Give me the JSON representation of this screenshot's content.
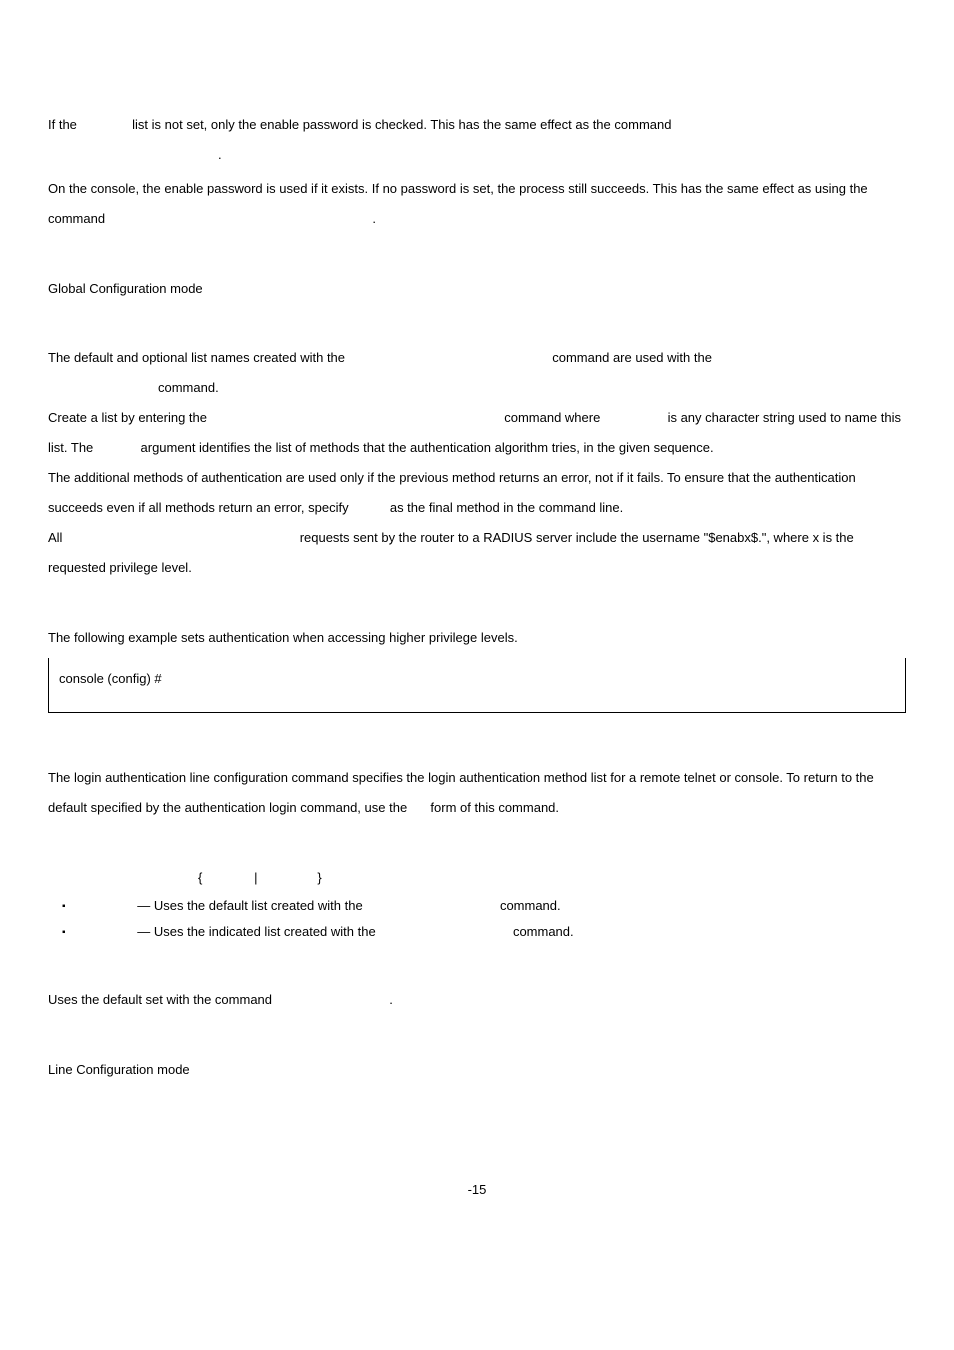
{
  "p1": {
    "a": "If the ",
    "b": " list is not set, only the enable password is checked. This has the same effect as the command"
  },
  "p2": ".",
  "p3": "On the console, the enable password is used if it exists. If no password is set, the process still succeeds. This has the same effect as using the command ",
  "p3_end": ".",
  "mode1": "Global Configuration mode",
  "ug1": {
    "a": "The default and optional list names created with the ",
    "b": " command are used with the "
  },
  "ug1_line2": " command.",
  "ug2": {
    "a": "Create a list by entering the ",
    "b": " command where ",
    "c": " is any character string used to name this list. The ",
    "d": " argument identifies the list of methods that the authentication algorithm tries, in the given sequence."
  },
  "ug3": {
    "a": "The additional methods of authentication are used only if the previous method returns an error, not if it fails. To ensure that the authentication succeeds even if all methods return an error, specify ",
    "b": " as the final method in the command line."
  },
  "ug4": {
    "a": "All ",
    "b": " requests sent by the router to a RADIUS server include the username \"$enabx$.\", where x is the requested privilege level."
  },
  "example_intro": "The following example sets authentication when accessing higher privilege levels.",
  "code_line": "console (config) # ",
  "la_desc": {
    "a": "The login authentication line configuration command specifies the login authentication method list for a remote telnet or console. To return to the default specified by the authentication login command, use the ",
    "b": " form of this command."
  },
  "syntax": {
    "open": "{",
    "pipe": "|",
    "close": "}"
  },
  "bullet1": {
    "a": " — Uses the default list created with the ",
    "b": " command."
  },
  "bullet2": {
    "a": " — Uses the indicated list created with the ",
    "b": " command."
  },
  "default_line": {
    "a": "Uses the default set with the command ",
    "b": "."
  },
  "mode2": "Line Configuration mode",
  "page_number": "-15"
}
